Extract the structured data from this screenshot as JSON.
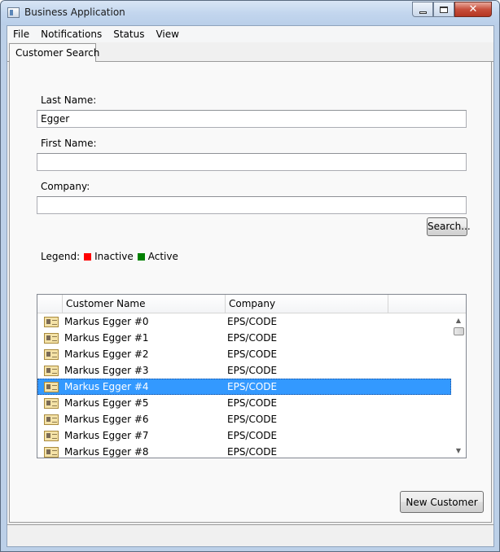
{
  "window": {
    "title": "Business Application"
  },
  "menu": {
    "items": [
      "File",
      "Notifications",
      "Status",
      "View"
    ]
  },
  "tabs": [
    {
      "label": "Customer Search"
    }
  ],
  "form": {
    "last_name_label": "Last Name:",
    "last_name_value": "Egger",
    "first_name_label": "First Name:",
    "first_name_value": "",
    "company_label": "Company:",
    "company_value": "",
    "search_button": "Search..."
  },
  "legend": {
    "label": "Legend:",
    "inactive": "Inactive",
    "active": "Active",
    "inactive_color": "#ff0000",
    "active_color": "#008000"
  },
  "grid": {
    "columns": [
      "Customer Name",
      "Company"
    ],
    "row_icon": "id-card-icon",
    "selected_index": 4,
    "rows": [
      {
        "name": "Markus Egger #0",
        "company": "EPS/CODE"
      },
      {
        "name": "Markus Egger #1",
        "company": "EPS/CODE"
      },
      {
        "name": "Markus Egger #2",
        "company": "EPS/CODE"
      },
      {
        "name": "Markus Egger #3",
        "company": "EPS/CODE"
      },
      {
        "name": "Markus Egger #4",
        "company": "EPS/CODE"
      },
      {
        "name": "Markus Egger #5",
        "company": "EPS/CODE"
      },
      {
        "name": "Markus Egger #6",
        "company": "EPS/CODE"
      },
      {
        "name": "Markus Egger #7",
        "company": "EPS/CODE"
      },
      {
        "name": "Markus Egger #8",
        "company": "EPS/CODE"
      }
    ]
  },
  "actions": {
    "new_customer_button": "New Customer"
  },
  "colors": {
    "selection": "#3399ff",
    "title_bar": "#c3d6ee"
  }
}
